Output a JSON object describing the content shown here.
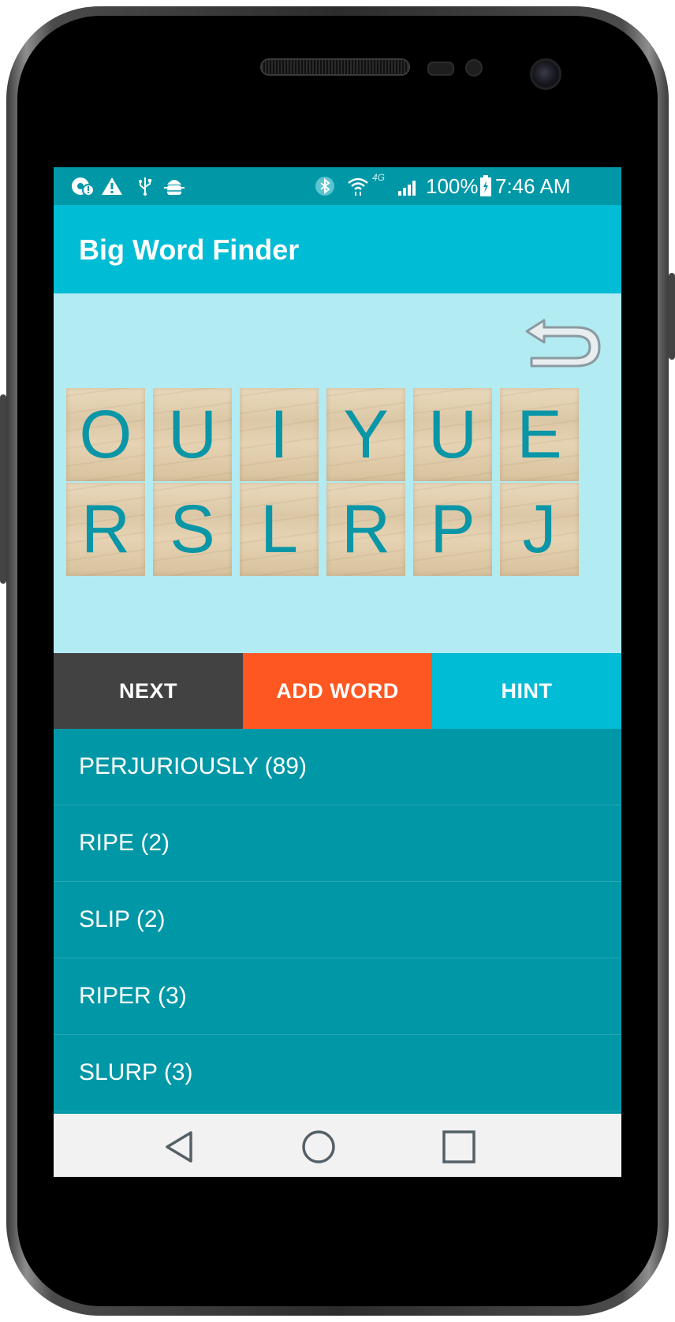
{
  "status_bar": {
    "battery": "100%",
    "time": "7:46 AM",
    "network": "4G",
    "icons": [
      "chrome-icon",
      "warning-icon",
      "usb-icon",
      "android-debug-icon",
      "bluetooth-icon",
      "wifi-icon",
      "signal-icon",
      "battery-charging-icon"
    ]
  },
  "app_bar": {
    "title": "Big Word Finder"
  },
  "board": {
    "undo_icon": "undo-arrow-icon",
    "rows": [
      [
        "O",
        "U",
        "I",
        "Y",
        "U",
        "E"
      ],
      [
        "R",
        "S",
        "L",
        "R",
        "P",
        "J"
      ]
    ]
  },
  "buttons": {
    "next": "NEXT",
    "add_word": "ADD WORD",
    "hint": "HINT"
  },
  "words": [
    "PERJURIOUSLY (89)",
    "RIPE (2)",
    "SLIP (2)",
    "RIPER (3)",
    "SLURP (3)"
  ],
  "colors": {
    "status_bar": "#0097a7",
    "app_bar": "#00bcd4",
    "play_area": "#b2ebf2",
    "next_button": "#424242",
    "add_word_button": "#ff5722",
    "hint_button": "#00bcd4",
    "list": "#0097a7",
    "tile_letter": "#0a96a6"
  },
  "nav_bar": {
    "back": "back-icon",
    "home": "home-icon",
    "recents": "recents-icon"
  }
}
